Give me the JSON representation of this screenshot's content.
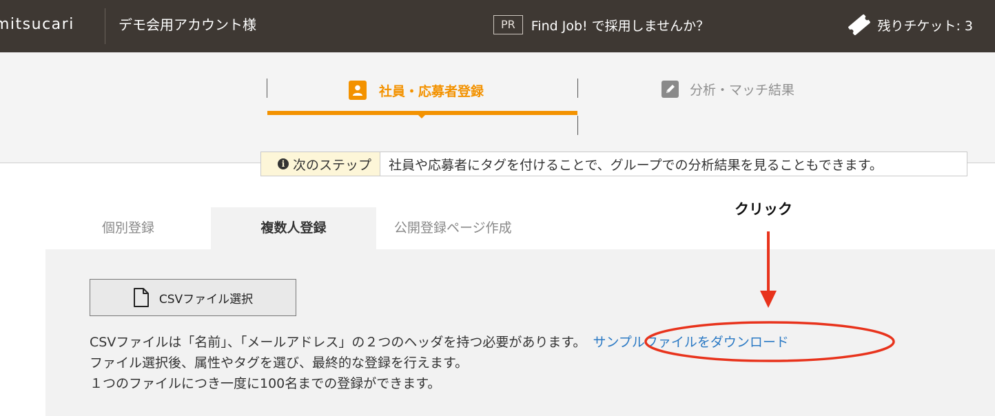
{
  "topbar": {
    "logo": "mitsucari",
    "account": "デモ会用アカウント様",
    "pr_badge": "PR",
    "pr_text": "Find Job! で採用しませんか？",
    "tickets": "残りチケット: 3",
    "ticket_icon": "ticket-icon"
  },
  "steps": {
    "step1_label": "社員・応募者登録",
    "step1_icon": "person-card-icon",
    "step2_label": "分析・マッチ結果",
    "step2_icon": "pencil-icon",
    "active_color": "#f39200"
  },
  "notice": {
    "label": "次のステップ",
    "text": "社員や応募者にタグを付けることで、グループでの分析結果を見ることもできます。"
  },
  "tabs": [
    {
      "label": "個別登録"
    },
    {
      "label": "複数人登録"
    },
    {
      "label": "公開登録ページ作成"
    }
  ],
  "panel": {
    "csv_button": "CSVファイル選択",
    "desc_line1": "CSVファイルは「名前」、「メールアドレス」の２つのヘッダを持つ必要があります。",
    "download_link": "サンプルファイルをダウンロード",
    "desc_line2": "ファイル選択後、属性やタグを選び、最終的な登録を行えます。",
    "desc_line3": "１つのファイルにつき一度に100名までの登録ができます。"
  },
  "annotation": {
    "label": "クリック",
    "color": "#e8331c"
  }
}
